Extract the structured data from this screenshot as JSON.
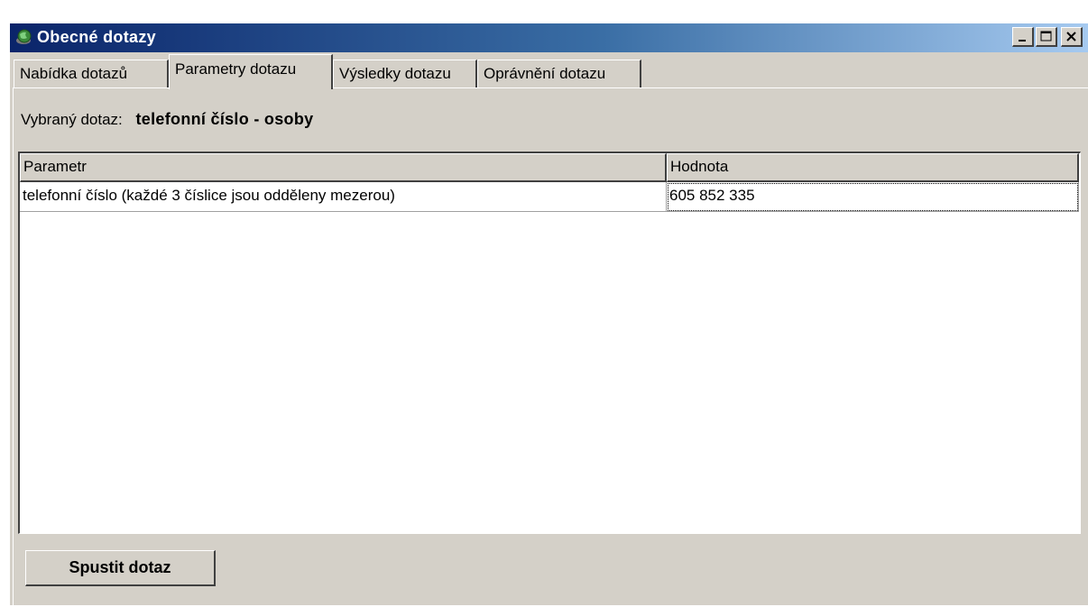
{
  "window": {
    "title": "Obecné dotazy",
    "icon": "app-globe-icon",
    "controls": {
      "minimize_icon": "minimize-icon",
      "maximize_icon": "maximize-icon",
      "close_icon": "close-icon"
    }
  },
  "tabs": [
    {
      "label": "Nabídka dotazů",
      "active": false
    },
    {
      "label": "Parametry dotazu",
      "active": true
    },
    {
      "label": "Výsledky dotazu",
      "active": false
    },
    {
      "label": "Oprávnění dotazu",
      "active": false
    }
  ],
  "query": {
    "label": "Vybraný dotaz:",
    "value": "telefonní číslo - osoby"
  },
  "grid": {
    "columns": [
      "Parametr",
      "Hodnota"
    ],
    "rows": [
      {
        "parameter": "telefonní číslo (každé 3 číslice jsou odděleny mezerou)",
        "value": "605 852 335"
      }
    ]
  },
  "actions": {
    "run_label": "Spustit dotaz"
  },
  "colors": {
    "titlebar_start": "#0a246a",
    "titlebar_end": "#a6caf0",
    "face": "#d4d0c8"
  }
}
